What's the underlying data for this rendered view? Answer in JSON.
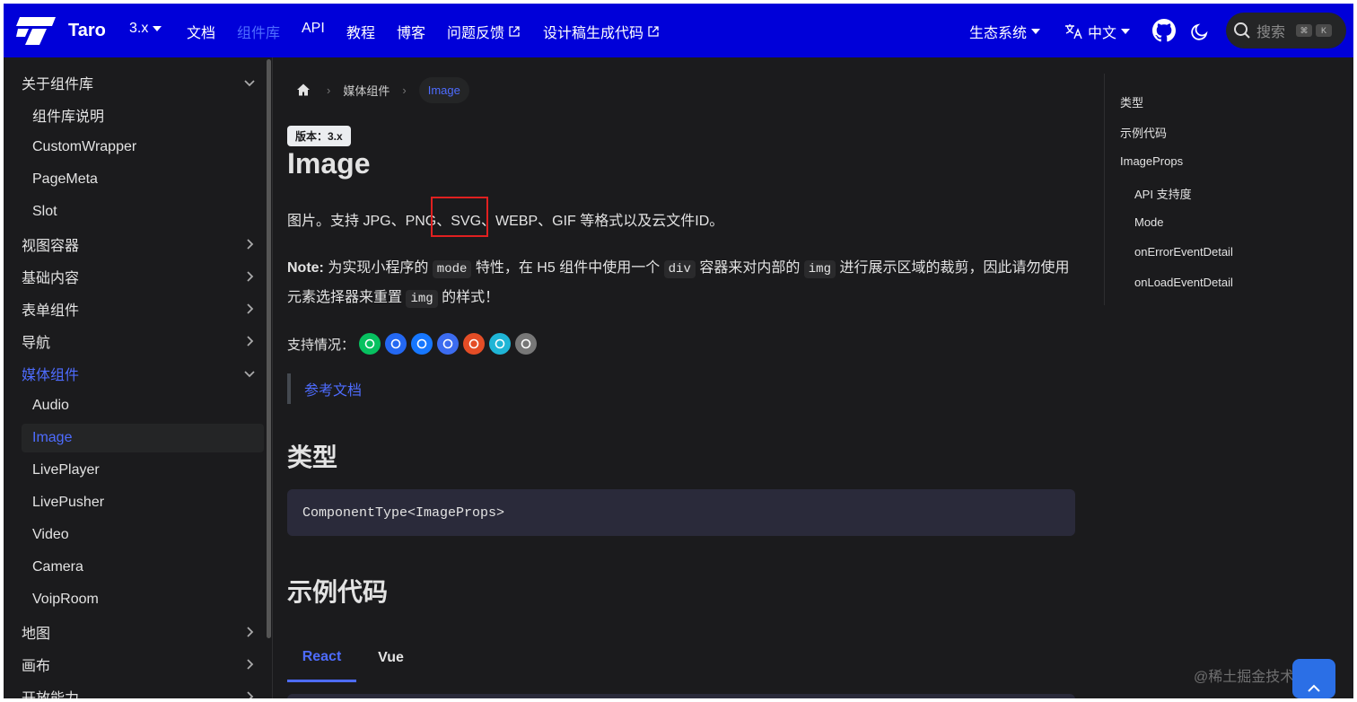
{
  "navbar": {
    "brand": "Taro",
    "version": "3.x",
    "items": [
      "文档",
      "组件库",
      "API",
      "教程",
      "博客"
    ],
    "feedback": "问题反馈",
    "design2code": "设计稿生成代码",
    "ecosystem": "生态系统",
    "language": "中文",
    "search_placeholder": "搜索",
    "kbd1": "⌘",
    "kbd2": "K"
  },
  "sidebar": {
    "items": [
      {
        "label": "关于组件库",
        "type": "category",
        "chevron": "down"
      },
      {
        "label": "组件库说明",
        "type": "sub"
      },
      {
        "label": "CustomWrapper",
        "type": "sub"
      },
      {
        "label": "PageMeta",
        "type": "sub"
      },
      {
        "label": "Slot",
        "type": "sub"
      },
      {
        "label": "视图容器",
        "type": "category",
        "chevron": "right"
      },
      {
        "label": "基础内容",
        "type": "category",
        "chevron": "right"
      },
      {
        "label": "表单组件",
        "type": "category",
        "chevron": "right"
      },
      {
        "label": "导航",
        "type": "category",
        "chevron": "right"
      },
      {
        "label": "媒体组件",
        "type": "category",
        "chevron": "down",
        "active": true
      },
      {
        "label": "Audio",
        "type": "sub"
      },
      {
        "label": "Image",
        "type": "sub",
        "selected": true
      },
      {
        "label": "LivePlayer",
        "type": "sub"
      },
      {
        "label": "LivePusher",
        "type": "sub"
      },
      {
        "label": "Video",
        "type": "sub"
      },
      {
        "label": "Camera",
        "type": "sub"
      },
      {
        "label": "VoipRoom",
        "type": "sub"
      },
      {
        "label": "地图",
        "type": "category",
        "chevron": "right"
      },
      {
        "label": "画布",
        "type": "category",
        "chevron": "right"
      },
      {
        "label": "开放能力",
        "type": "category",
        "chevron": "right"
      }
    ]
  },
  "breadcrumb": {
    "section": "媒体组件",
    "current": "Image"
  },
  "doc": {
    "version_badge": "版本：3.x",
    "title": "Image",
    "intro_a": "图片。支持 JPG、PNG",
    "intro_b": "、SVG、",
    "intro_c": "WEBP、GIF 等格式以及云文件ID。",
    "note_label": "Note:",
    "note_t1": " 为实现小程序的 ",
    "note_c1": "mode",
    "note_t2": " 特性，在 H5 组件中使用一个 ",
    "note_c2": "div",
    "note_t3": " 容器来对内部的 ",
    "note_c3": "img",
    "note_t4": " 进行展示区域的裁剪，因此请勿使用",
    "note2_t1": "元素选择器来重置 ",
    "note2_c1": "img",
    "note2_t2": " 的样式！",
    "support_label": "支持情况：",
    "ref_link": "参考文档",
    "h_type": "类型",
    "type_code": "ComponentType<ImageProps>",
    "h_example": "示例代码",
    "tabs": [
      "React",
      "Vue"
    ]
  },
  "support_icons": [
    {
      "name": "weapp",
      "color": "#07c160"
    },
    {
      "name": "swan",
      "color": "#2468f2"
    },
    {
      "name": "alipay",
      "color": "#1677ff"
    },
    {
      "name": "tt",
      "color": "#3c6cf0"
    },
    {
      "name": "h5",
      "color": "#e44d26"
    },
    {
      "name": "rn",
      "color": "#1fb5d6"
    },
    {
      "name": "harmony",
      "color": "#777777"
    }
  ],
  "toc": [
    "类型",
    "示例代码",
    "ImageProps",
    "API 支持度",
    "Mode",
    "onErrorEventDetail",
    "onLoadEventDetail"
  ],
  "watermark": "@稀土掘金技术社区"
}
